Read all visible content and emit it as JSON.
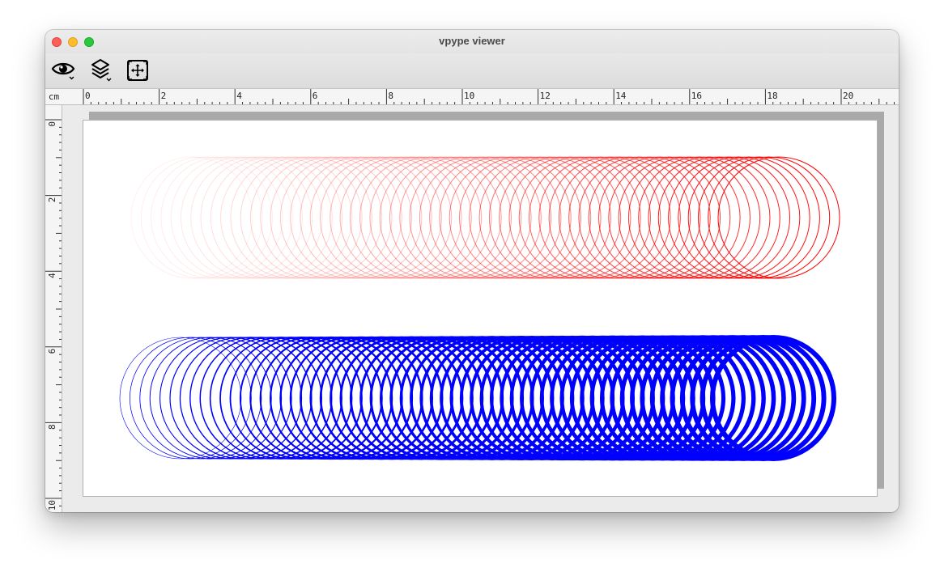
{
  "window": {
    "title": "vpype viewer"
  },
  "toolbar": {
    "buttons": [
      {
        "icon": "eye-icon",
        "menu": true
      },
      {
        "icon": "layers-icon",
        "menu": true
      },
      {
        "icon": "fit-to-page-icon",
        "menu": false
      }
    ]
  },
  "ruler": {
    "unit": "cm",
    "horizontal_labels": [
      "0",
      "2",
      "4",
      "6",
      "8",
      "10",
      "12",
      "14",
      "16",
      "18",
      "20"
    ],
    "vertical_labels": [
      "0",
      "2",
      "4",
      "6",
      "8",
      "10"
    ]
  },
  "colors": {
    "layer1": "#ff0000",
    "layer2": "#0000ff",
    "paper": "#ffffff",
    "canvas_background": "#ebebeb"
  },
  "layers": [
    {
      "color": "#ff0000",
      "circle_count": 60,
      "opacity_from": 0.06,
      "opacity_to": 1.0
    },
    {
      "color": "#0000ff",
      "circle_count": 60,
      "width_from": 0.6,
      "width_to": 6.0
    }
  ]
}
